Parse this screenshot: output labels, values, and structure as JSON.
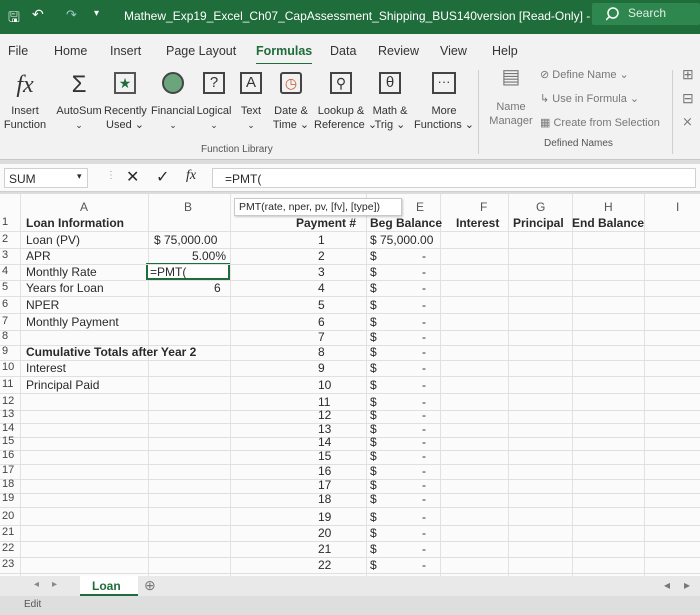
{
  "window": {
    "title": "Mathew_Exp19_Excel_Ch07_CapAssessment_Shipping_BUS140version [Read-Only] - Ex...",
    "search": "Search"
  },
  "tabs": [
    "File",
    "Home",
    "Insert",
    "Page Layout",
    "Formulas",
    "Data",
    "Review",
    "View",
    "Help"
  ],
  "ribbon": {
    "insert_function": [
      "Insert",
      "Function"
    ],
    "autosum": "AutoSum",
    "recently_used": [
      "Recently",
      "Used"
    ],
    "financial": "Financial",
    "logical": "Logical",
    "text": "Text",
    "date_time": [
      "Date &",
      "Time"
    ],
    "lookup": [
      "Lookup &",
      "Reference"
    ],
    "math": [
      "Math &",
      "Trig"
    ],
    "more": [
      "More",
      "Functions"
    ],
    "group_label": "Function Library",
    "name_manager": [
      "Name",
      "Manager"
    ],
    "define_name": "Define Name",
    "use_in_formula": "Use in Formula",
    "create_from_selection": "Create from Selection",
    "defined_names": "Defined Names"
  },
  "formula_bar": {
    "name_box": "SUM",
    "fx": "fx",
    "formula": "=PMT("
  },
  "tooltip": "PMT(rate, nper, pv, [fv], [type])",
  "columns": {
    "A": "A",
    "B": "B",
    "E": "E",
    "F": "F",
    "G": "G",
    "H": "H",
    "I": "I"
  },
  "headers_row1": {
    "a1": "Loan Information",
    "d1": "Payment #",
    "e1": "Beg Balance",
    "f1": "Interest",
    "g1": "Principal",
    "h1": "End Balance"
  },
  "labels": {
    "a2": "Loan (PV)",
    "a3": "APR",
    "a4": "Monthly Rate",
    "a5": "Years for Loan",
    "a6": "NPER",
    "a7": "Monthly Payment",
    "a9": "Cumulative Totals after Year 2",
    "a10": "Interest",
    "a11": "Principal Paid"
  },
  "values": {
    "b2": "$ 75,000.00",
    "b3": "5.00%",
    "b4": "=PMT(",
    "b5": "6",
    "e2": "$ 75,000.00"
  },
  "row_numbers": [
    "1",
    "2",
    "3",
    "4",
    "5",
    "6",
    "7",
    "8",
    "9",
    "10",
    "11",
    "12",
    "13",
    "14",
    "15",
    "16",
    "17",
    "18",
    "19",
    "20",
    "21",
    "22",
    "23"
  ],
  "payments": [
    "1",
    "2",
    "3",
    "4",
    "5",
    "6",
    "7",
    "8",
    "9",
    "10",
    "11",
    "12",
    "13",
    "14",
    "15",
    "16",
    "17",
    "18",
    "19",
    "20",
    "21",
    "22"
  ],
  "dollar": "$",
  "dash": "-",
  "sheet_tab": "Loan",
  "status": "Edit"
}
